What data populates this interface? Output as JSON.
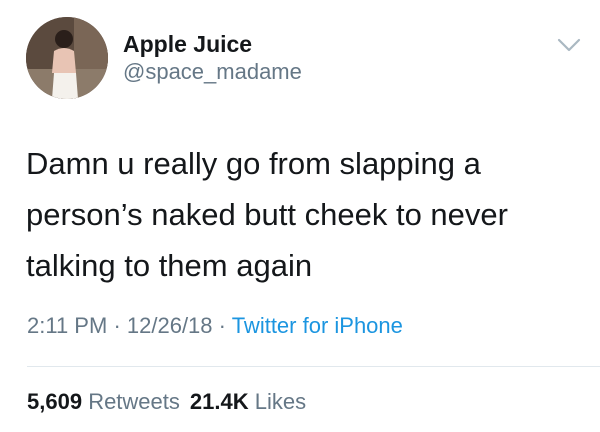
{
  "user": {
    "name": "Apple Juice",
    "handle": "@space_madame"
  },
  "tweet": {
    "text": "Damn u really go from slapping a person’s naked butt cheek to never talking to them again"
  },
  "meta": {
    "time": "2:11 PM",
    "separator": "·",
    "date": "12/26/18",
    "source": "Twitter for iPhone"
  },
  "stats": {
    "retweets_count": "5,609",
    "retweets_label": "Retweets",
    "likes_count": "21.4K",
    "likes_label": "Likes"
  },
  "colors": {
    "link": "#1b95e0",
    "secondary_text": "#657786",
    "primary_text": "#14171a"
  },
  "icons": {
    "menu": "chevron-down-icon"
  }
}
